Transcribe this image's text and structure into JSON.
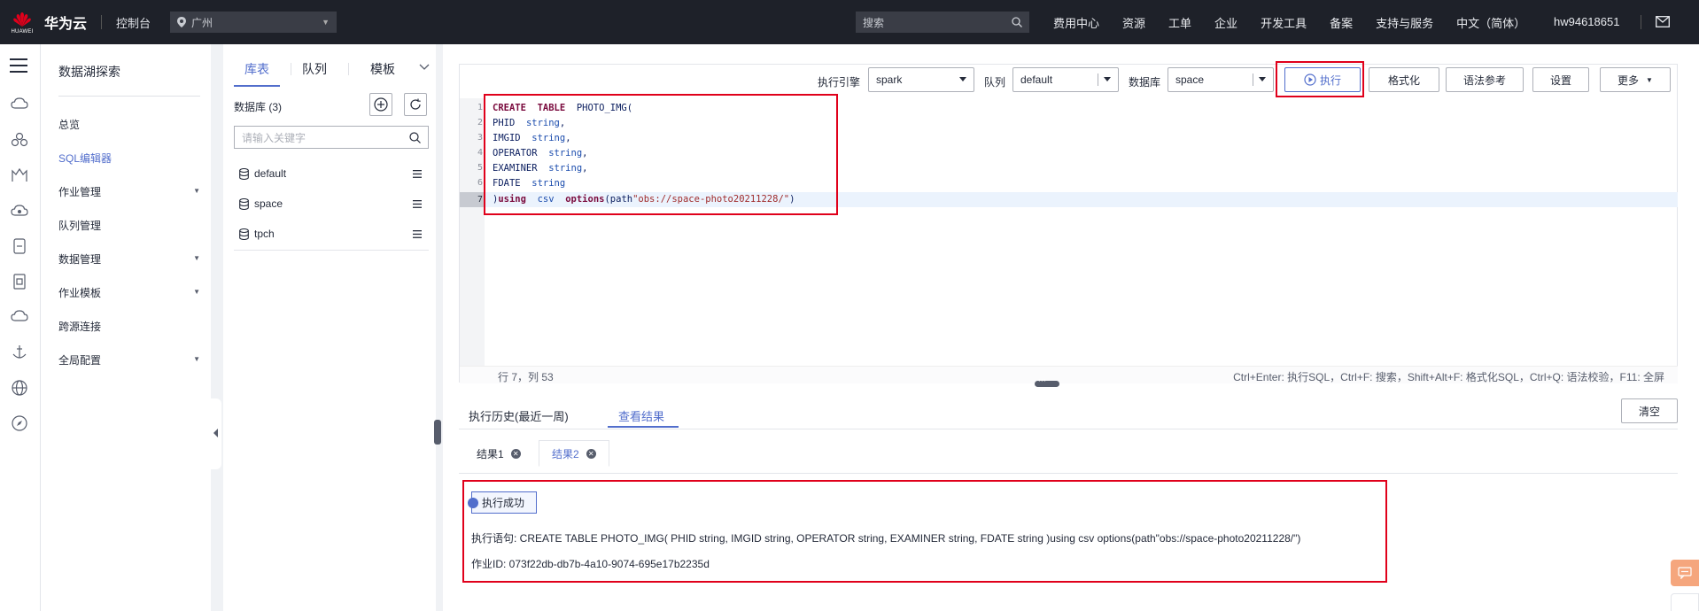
{
  "topbar": {
    "logo_text": "HUAWEI",
    "brand": "华为云",
    "console": "控制台",
    "region": "广州",
    "search_placeholder": "搜索",
    "menu": [
      "费用中心",
      "资源",
      "工单",
      "企业",
      "开发工具",
      "备案",
      "支持与服务",
      "中文（简体）"
    ],
    "user": "hw94618651"
  },
  "sidebar": {
    "title": "数据湖探索",
    "items": [
      {
        "label": "总览",
        "has_arrow": false
      },
      {
        "label": "SQL编辑器",
        "has_arrow": false,
        "active": true
      },
      {
        "label": "作业管理",
        "has_arrow": true
      },
      {
        "label": "队列管理",
        "has_arrow": false
      },
      {
        "label": "数据管理",
        "has_arrow": true
      },
      {
        "label": "作业模板",
        "has_arrow": true
      },
      {
        "label": "跨源连接",
        "has_arrow": false
      },
      {
        "label": "全局配置",
        "has_arrow": true
      }
    ]
  },
  "dbpanel": {
    "tabs": [
      "库表",
      "队列",
      "模板"
    ],
    "count_label": "数据库 (3)",
    "search_placeholder": "请输入关键字",
    "databases": [
      "default",
      "space",
      "tpch"
    ]
  },
  "toolbar": {
    "engine_label": "执行引擎",
    "engine_value": "spark",
    "queue_label": "队列",
    "queue_value": "default",
    "db_label": "数据库",
    "db_value": "space",
    "run": "执行",
    "format": "格式化",
    "syntax": "语法参考",
    "settings": "设置",
    "more": "更多"
  },
  "editor": {
    "lines": [
      "CREATE TABLE PHOTO_IMG(",
      "PHID string,",
      "IMGID string,",
      "OPERATOR string,",
      "EXAMINER string,",
      "FDATE string",
      ")using csv options(path\"obs://space-photo20211228/\")"
    ],
    "status_pos": "行 7，列 53",
    "shortcuts": "Ctrl+Enter: 执行SQL，Ctrl+F: 搜索，Shift+Alt+F: 格式化SQL，Ctrl+Q: 语法校验，F11: 全屏"
  },
  "results": {
    "tabs": [
      "执行历史(最近一周)",
      "查看结果"
    ],
    "clear": "清空",
    "result_tabs": [
      "结果1",
      "结果2"
    ],
    "status": "执行成功",
    "statement": "执行语句: CREATE TABLE PHOTO_IMG( PHID string, IMGID string, OPERATOR string, EXAMINER string, FDATE string )using csv options(path\"obs://space-photo20211228/\")",
    "job_id": "作业ID: 073f22db-db7b-4a10-9074-695e17b2235d"
  },
  "colors": {
    "accent": "#526ecc",
    "highlight_box": "#e0001b",
    "topbar": "#1e2129"
  }
}
